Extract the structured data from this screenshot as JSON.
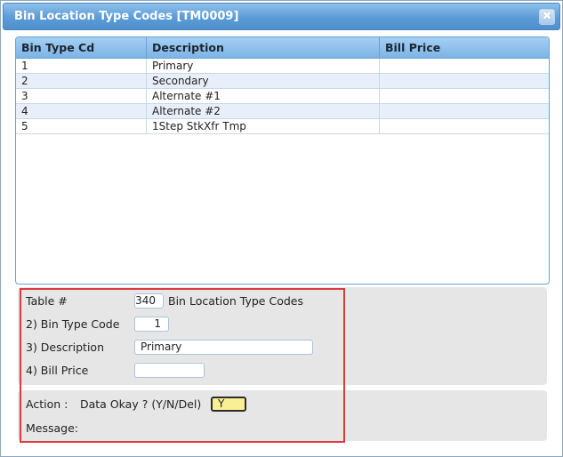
{
  "window": {
    "title": "Bin Location Type Codes [TM0009]",
    "close_glyph": "✖"
  },
  "grid": {
    "columns": [
      "Bin Type Cd",
      "Description",
      "Bill Price"
    ],
    "rows": [
      {
        "code": "1",
        "description": "Primary",
        "bill_price": ""
      },
      {
        "code": "2",
        "description": "Secondary",
        "bill_price": ""
      },
      {
        "code": "3",
        "description": "Alternate #1",
        "bill_price": ""
      },
      {
        "code": "4",
        "description": "Alternate #2",
        "bill_price": ""
      },
      {
        "code": "5",
        "description": "1Step StkXfr Tmp",
        "bill_price": ""
      }
    ]
  },
  "form": {
    "table_label": "Table #",
    "table_value": "340",
    "table_name": "Bin Location Type Codes",
    "bin_type_label": "2) Bin Type Code",
    "bin_type_value": "1",
    "description_label": "3) Description",
    "description_value": "Primary",
    "bill_price_label": "4) Bill Price",
    "bill_price_value": ""
  },
  "action": {
    "action_label": "Action :",
    "prompt": "Data Okay ? (Y/N/Del)",
    "value": "Y",
    "message_label": "Message:",
    "message_value": ""
  },
  "colors": {
    "title_bar": "#5c9bd6",
    "highlight_border": "#dc3b3b",
    "action_field": "#fbef96"
  }
}
